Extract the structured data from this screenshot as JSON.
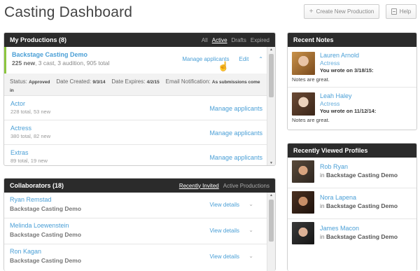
{
  "header": {
    "title": "Casting Dashboard",
    "new_production_label": "Create New Production",
    "help_label": "Help"
  },
  "productions": {
    "title": "My Productions (8)",
    "filters": [
      "All",
      "Active",
      "Drafts",
      "Expired"
    ],
    "active_filter": "Active",
    "selected": {
      "name": "Backstage Casting Demo",
      "new_count": "225 new",
      "summary": ", 3 cast, 3 audition, 905 total",
      "manage_label": "Manage applicants",
      "edit_label": "Edit",
      "status_label": "Status:",
      "status_value": "Approved",
      "created_label": "Date Created:",
      "created_value": "9/3/14",
      "expires_label": "Date Expires:",
      "expires_value": "4/2/15",
      "email_label": "Email Notification:",
      "email_value": "As submissions come in"
    },
    "roles": [
      {
        "name": "Actor",
        "sub": "228 total, 53 new",
        "link": "Manage applicants"
      },
      {
        "name": "Actress",
        "sub": "380 total, 82 new",
        "link": "Manage applicants"
      },
      {
        "name": "Extras",
        "sub": "89 total, 19 new",
        "link": "Manage applicants"
      }
    ]
  },
  "collaborators": {
    "title": "Collaborators (18)",
    "filters": [
      "Recently Invited",
      "Active Productions"
    ],
    "active_filter": "Recently Invited",
    "rows": [
      {
        "name": "Ryan Remstad",
        "production": "Backstage Casting Demo",
        "action": "View details"
      },
      {
        "name": "Melinda Loewenstein",
        "production": "Backstage Casting Demo",
        "action": "View details"
      },
      {
        "name": "Ron Kagan",
        "production": "Backstage Casting Demo",
        "action": "View details"
      }
    ]
  },
  "recent_notes": {
    "title": "Recent Notes",
    "items": [
      {
        "name": "Lauren Arnold",
        "role": "Actress",
        "wrote": "You wrote on 3/18/15:",
        "text": "Notes are great."
      },
      {
        "name": "Leah Haley",
        "role": "Actress",
        "wrote": "You wrote on 11/12/14:",
        "text": "Notes are great."
      }
    ]
  },
  "recently_viewed": {
    "title": "Recently Viewed Profiles",
    "in_label": "in",
    "items": [
      {
        "name": "Rob Ryan",
        "production": "Backstage Casting Demo"
      },
      {
        "name": "Nora Lapena",
        "production": "Backstage Casting Demo"
      },
      {
        "name": "James Macon",
        "production": "Backstage Casting Demo"
      }
    ]
  },
  "colors": {
    "link": "#4a9fd6",
    "header_bg": "#2b2b2b",
    "selected_accent": "#8dc63f"
  }
}
